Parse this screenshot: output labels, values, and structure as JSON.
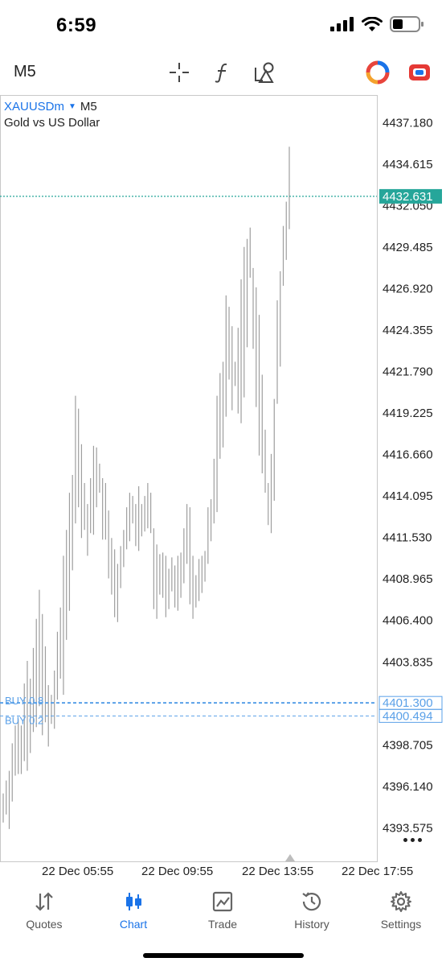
{
  "status": {
    "time": "6:59"
  },
  "toolbar": {
    "timeframe": "M5",
    "icons": [
      "crosshair-icon",
      "function-icon",
      "objects-icon",
      "multicolor-circle-icon",
      "trade-toggle-icon"
    ]
  },
  "chart": {
    "symbol": "XAUUSDm",
    "timeframe": "M5",
    "description": "Gold vs US Dollar",
    "price_tag": "4432.631",
    "orders": [
      {
        "label": "BUY 0.8",
        "price": "4401.300"
      },
      {
        "label": "BUY 0.2",
        "price": "4400.494"
      }
    ],
    "colors": {
      "accent": "#1a73e8",
      "bars": "#9e9e9e",
      "price_line": "#26a69a",
      "order_line": "#5aa0e8"
    }
  },
  "chart_data": {
    "type": "bar",
    "yticks": [
      "4437.180",
      "4434.615",
      "4432.050",
      "4429.485",
      "4426.920",
      "4424.355",
      "4421.790",
      "4419.225",
      "4416.660",
      "4414.095",
      "4411.530",
      "4408.965",
      "4406.400",
      "4403.835",
      "4398.705",
      "4396.140",
      "4393.575"
    ],
    "xticks": [
      "22 Dec 05:55",
      "22 Dec 09:55",
      "22 Dec 13:55",
      "22 Dec 17:55"
    ],
    "ylim": [
      4391.5,
      4438.9
    ],
    "current_price": 4432.631,
    "ohlc_ranges": [
      [
        4395.7,
        4393.9
      ],
      [
        4396.5,
        4394.4
      ],
      [
        4397.1,
        4393.5
      ],
      [
        4398.8,
        4395.2
      ],
      [
        4399.9,
        4396.8
      ],
      [
        4400.3,
        4396.9
      ],
      [
        4399.9,
        4396.9
      ],
      [
        4402.5,
        4397.7
      ],
      [
        4403.9,
        4397.1
      ],
      [
        4402.8,
        4398.2
      ],
      [
        4404.7,
        4399.5
      ],
      [
        4406.5,
        4399.8
      ],
      [
        4408.3,
        4401.1
      ],
      [
        4406.8,
        4399.3
      ],
      [
        4404.8,
        4400.1
      ],
      [
        4402.4,
        4398.6
      ],
      [
        4401.8,
        4400.0
      ],
      [
        4403.3,
        4399.7
      ],
      [
        4405.7,
        4401.5
      ],
      [
        4407.2,
        4402.8
      ],
      [
        4410.4,
        4401.8
      ],
      [
        4412.0,
        4405.2
      ],
      [
        4414.3,
        4407.0
      ],
      [
        4415.4,
        4409.5
      ],
      [
        4420.3,
        4412.4
      ],
      [
        4419.5,
        4413.4
      ],
      [
        4417.3,
        4411.5
      ],
      [
        4414.9,
        4412.0
      ],
      [
        4413.6,
        4410.4
      ],
      [
        4415.2,
        4411.8
      ],
      [
        4417.2,
        4411.7
      ],
      [
        4417.1,
        4413.4
      ],
      [
        4416.1,
        4414.3
      ],
      [
        4415.2,
        4411.4
      ],
      [
        4414.9,
        4411.4
      ],
      [
        4413.2,
        4409.0
      ],
      [
        4411.5,
        4408.0
      ],
      [
        4410.8,
        4406.6
      ],
      [
        4409.9,
        4406.3
      ],
      [
        4411.0,
        4408.4
      ],
      [
        4412.0,
        4409.7
      ],
      [
        4413.4,
        4410.8
      ],
      [
        4414.3,
        4411.3
      ],
      [
        4414.1,
        4412.4
      ],
      [
        4413.6,
        4411.0
      ],
      [
        4414.7,
        4410.7
      ],
      [
        4413.6,
        4411.6
      ],
      [
        4414.1,
        4411.9
      ],
      [
        4414.9,
        4412.1
      ],
      [
        4414.3,
        4411.8
      ],
      [
        4412.1,
        4407.1
      ],
      [
        4411.1,
        4406.5
      ],
      [
        4410.5,
        4408.0
      ],
      [
        4410.6,
        4407.8
      ],
      [
        4410.4,
        4406.6
      ],
      [
        4409.6,
        4407.1
      ],
      [
        4410.3,
        4408.2
      ],
      [
        4409.8,
        4407.2
      ],
      [
        4410.4,
        4407.0
      ],
      [
        4410.6,
        4407.8
      ],
      [
        4412.1,
        4408.7
      ],
      [
        4413.6,
        4409.9
      ],
      [
        4413.4,
        4407.4
      ],
      [
        4410.4,
        4406.5
      ],
      [
        4409.2,
        4407.2
      ],
      [
        4410.2,
        4407.6
      ],
      [
        4410.4,
        4408.1
      ],
      [
        4410.7,
        4408.8
      ],
      [
        4413.4,
        4409.9
      ],
      [
        4413.9,
        4411.3
      ],
      [
        4416.4,
        4412.4
      ],
      [
        4420.3,
        4413.1
      ],
      [
        4421.7,
        4416.4
      ],
      [
        4422.4,
        4417.1
      ],
      [
        4426.5,
        4419.0
      ],
      [
        4425.8,
        4421.3
      ],
      [
        4424.6,
        4419.4
      ],
      [
        4422.4,
        4420.9
      ],
      [
        4424.5,
        4419.2
      ],
      [
        4427.5,
        4418.6
      ],
      [
        4429.5,
        4420.2
      ],
      [
        4430.0,
        4423.3
      ],
      [
        4430.7,
        4427.6
      ],
      [
        4428.2,
        4423.2
      ],
      [
        4427.0,
        4419.6
      ],
      [
        4425.3,
        4416.6
      ],
      [
        4421.6,
        4415.5
      ],
      [
        4418.2,
        4414.3
      ],
      [
        4414.9,
        4412.3
      ],
      [
        4416.7,
        4411.8
      ],
      [
        4420.1,
        4413.8
      ],
      [
        4426.2,
        4419.8
      ],
      [
        4428.0,
        4422.1
      ],
      [
        4430.8,
        4427.1
      ],
      [
        4432.3,
        4428.7
      ],
      [
        4435.7,
        4430.6
      ]
    ]
  },
  "nav": {
    "items": [
      {
        "label": "Quotes",
        "icon": "quotes-arrows-icon"
      },
      {
        "label": "Chart",
        "icon": "chart-candles-icon"
      },
      {
        "label": "Trade",
        "icon": "trade-chart-icon"
      },
      {
        "label": "History",
        "icon": "history-clock-icon"
      },
      {
        "label": "Settings",
        "icon": "settings-gear-icon"
      }
    ]
  }
}
